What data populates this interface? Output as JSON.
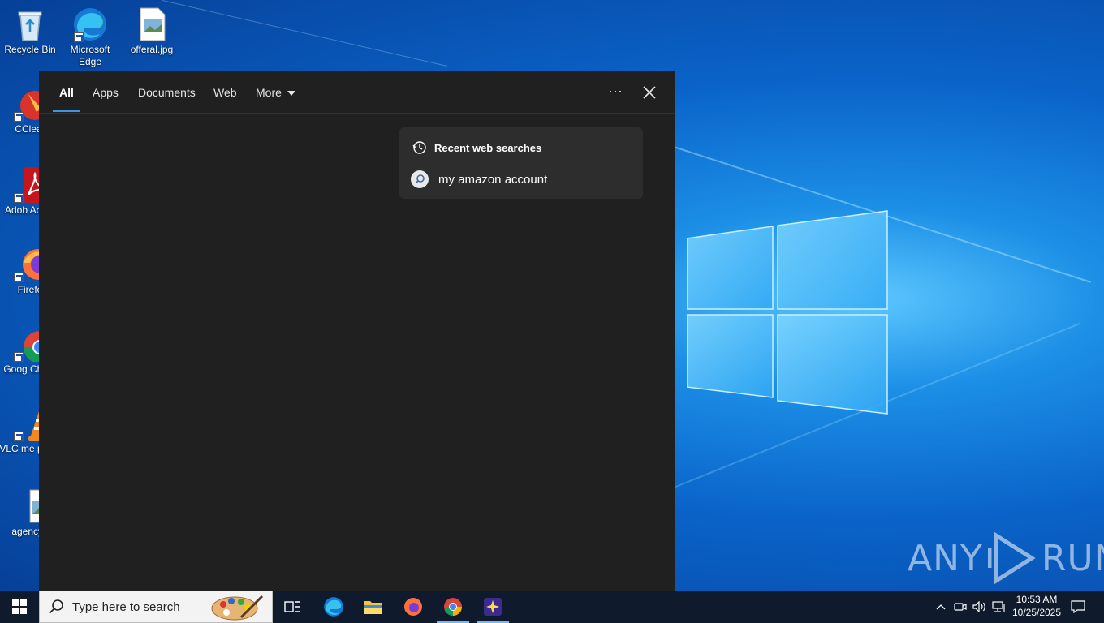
{
  "desktop": {
    "icons": [
      {
        "label": "Recycle Bin",
        "icon": "recycle-bin-icon"
      },
      {
        "label": "Microsoft Edge",
        "icon": "edge-icon"
      },
      {
        "label": "offeral.jpg",
        "icon": "image-file-icon"
      },
      {
        "label": "CClear",
        "icon": "ccleaner-icon"
      },
      {
        "label": "Adob Acrob",
        "icon": "acrobat-icon"
      },
      {
        "label": "Firefo",
        "icon": "firefox-icon"
      },
      {
        "label": "Goog Chron",
        "icon": "chrome-icon"
      },
      {
        "label": "VLC me playe",
        "icon": "vlc-icon"
      },
      {
        "label": "agencyo",
        "icon": "image-file-icon"
      }
    ]
  },
  "search_panel": {
    "tabs": [
      {
        "label": "All",
        "active": true
      },
      {
        "label": "Apps"
      },
      {
        "label": "Documents"
      },
      {
        "label": "Web"
      },
      {
        "label": "More"
      }
    ],
    "more_options_label": "···",
    "recent_title": "Recent web searches",
    "recent_items": [
      {
        "label": "my amazon account"
      }
    ]
  },
  "watermark": {
    "left": "ANY",
    "right": "RUN"
  },
  "taskbar": {
    "search_placeholder": "Type here to search",
    "clock": {
      "time": "10:53 AM",
      "date": "10/25/2025"
    }
  },
  "colors": {
    "accent": "#3a96dd",
    "panel_bg": "#202020",
    "card_bg": "#2d2d2d",
    "taskbar_bg": "#0f1a2c"
  }
}
